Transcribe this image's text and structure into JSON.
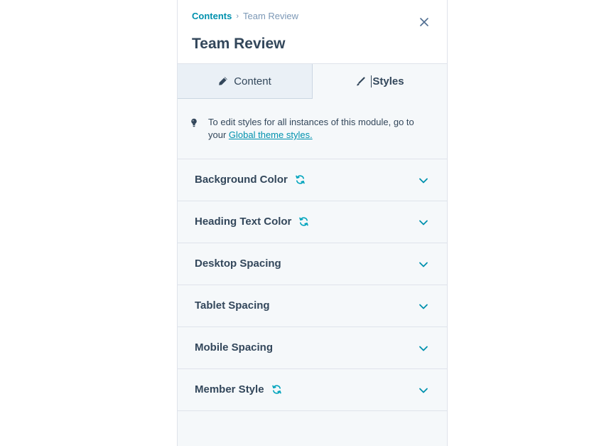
{
  "breadcrumb": {
    "parent": "Contents",
    "separator": "›",
    "current": "Team Review"
  },
  "title": "Team Review",
  "tabs": [
    {
      "label": "Content",
      "icon": "pencil-icon",
      "active": false
    },
    {
      "label": "Styles",
      "icon": "brush-icon",
      "active": true
    }
  ],
  "notice": {
    "text": "To edit styles for all instances of this module, go to your ",
    "link": "Global theme styles."
  },
  "sections": [
    {
      "label": "Background Color",
      "sync": true
    },
    {
      "label": "Heading Text Color",
      "sync": true
    },
    {
      "label": "Desktop Spacing",
      "sync": false
    },
    {
      "label": "Tablet Spacing",
      "sync": false
    },
    {
      "label": "Mobile Spacing",
      "sync": false
    },
    {
      "label": "Member Style",
      "sync": true
    }
  ],
  "colors": {
    "accent": "#0091ae",
    "text": "#33475b",
    "muted": "#7c98b6",
    "panel_bg": "#f5f8fa",
    "tab_inactive_bg": "#eaf0f6",
    "sync_icon": "#00a4bd"
  }
}
